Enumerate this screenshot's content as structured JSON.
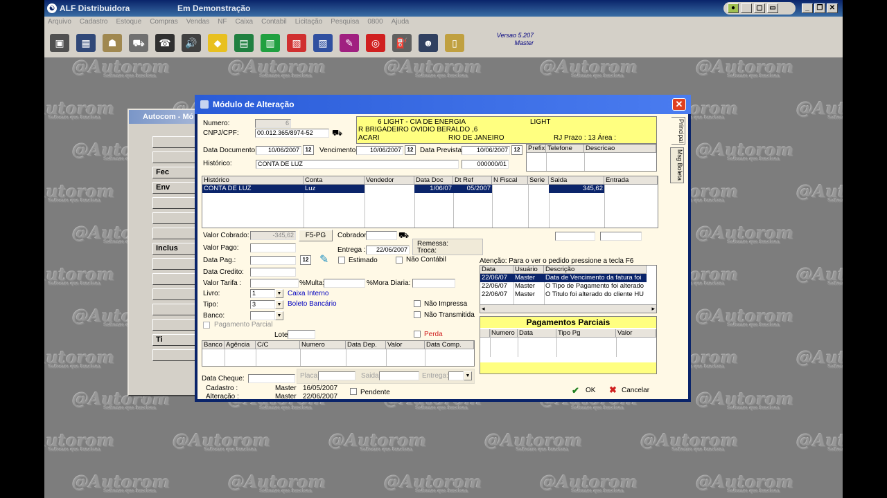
{
  "app": {
    "title": "ALF Distribuidora",
    "mode": "Em Demonstração"
  },
  "menu": [
    "Arquivo",
    "Cadastro",
    "Estoque",
    "Compras",
    "Vendas",
    "NF",
    "Caixa",
    "Contabil",
    "Licitação",
    "Pesquisa",
    "0800",
    "Ajuda"
  ],
  "toolbar_icons": [
    "printer-icon",
    "calculator-icon",
    "handshake-icon",
    "truck-icon",
    "telephone-icon",
    "speaker-icon",
    "sign-icon",
    "chart-icon",
    "money-icon",
    "document-icon",
    "notes-icon",
    "tools-icon",
    "target-icon",
    "gas-pump-icon",
    "people-icon",
    "phone-icon"
  ],
  "toolbar_colors": [
    "#505050",
    "#304878",
    "#a08850",
    "#707070",
    "#303030",
    "#404040",
    "#e8c020",
    "#208040",
    "#20a040",
    "#d03030",
    "#3050a0",
    "#a02080",
    "#d02020",
    "#606060",
    "#304060",
    "#c0a040"
  ],
  "version": {
    "line1": "Versao 5.207",
    "line2": "Master"
  },
  "watermark": {
    "text": "@Autorom",
    "tagline": "Software que funciona"
  },
  "background_window": {
    "title": "Autocom - Mó",
    "buttons": [
      "",
      "",
      "Fec",
      "Env",
      "",
      "",
      "",
      "Inclus",
      "",
      "",
      "",
      "",
      "",
      "Ti",
      ""
    ]
  },
  "dialog": {
    "title": "Módulo de Alteração",
    "tabs": [
      "Principal",
      "Msg Boleta"
    ],
    "numero_label": "Numero:",
    "numero_value": "6",
    "cnpj_label": "CNPJ/CPF:",
    "cnpj_value": "00.012.365/8974-52",
    "client_box": {
      "line1": "6    LIGHT - CIA DE ENERGIA",
      "line1b": "LIGHT",
      "line2": "R BRIGADEIRO OVIDIO BERALDO ,6",
      "line3a": "ACARI",
      "line3b": "RIO DE JANEIRO",
      "line3c": "RJ    Prazo :   13    Área :"
    },
    "data_doc_label": "Data Documento:",
    "data_doc_value": "10/06/2007",
    "vencimento_label": "Vencimento",
    "vencimento_value": "10/06/2007",
    "data_prevista_label": "Data Prevista",
    "data_prevista_value": "10/06/2007",
    "historico_label": "Histórico:",
    "historico_value": "CONTA DE LUZ",
    "historico_code": "000000/01",
    "phone_headers": [
      "Prefix",
      "Telefone",
      "Descricao"
    ],
    "cal_label": "12",
    "main_grid": {
      "headers": [
        "Histórico",
        "Conta",
        "Vendedor",
        "Data Doc",
        "Dt Ref",
        "N Fiscal",
        "Serie",
        "Saida",
        "Entrada"
      ],
      "row": [
        "CONTA DE LUZ",
        "Luz",
        "",
        "1/06/07",
        "05/2007",
        "",
        "",
        "345,62",
        ""
      ]
    },
    "valor_cobrado_label": "Valor Cobrado:",
    "valor_cobrado_value": "-345,62",
    "f5_label": "F5-PG",
    "cobrador_label": "Cobrador",
    "remessa_label": "Remessa:",
    "troca_label": "Troca:",
    "valor_pago_label": "Valor Pago:",
    "entrega_label": "Entrega :",
    "entrega_value": "22/06/2007",
    "data_pag_label": "Data Pag.:",
    "estimado_label": "Estimado",
    "nao_contabil_label": "Não Contábil",
    "data_credito_label": "Data Credito:",
    "valor_tarifa_label": "Valor Tarifa :",
    "multa_label": "%Multa:",
    "mora_label": "%Mora Diaria:",
    "livro_label": "Livro:",
    "livro_value": "1",
    "livro_desc": "Caixa Interno",
    "tipo_label": "Tipo:",
    "tipo_value": "3",
    "tipo_desc": "Boleto Bancário",
    "banco_label": "Banco:",
    "nao_impressa_label": "Não Impressa",
    "nao_transmitida_label": "Não Transmitida",
    "pagamento_parcial_label": "Pagamento Parcial",
    "lote_label": "Lote",
    "perda_label": "Perda",
    "bank_grid_headers": [
      "Banco",
      "Agência",
      "C/C",
      "Numero",
      "Data Dep.",
      "Valor",
      "Data Comp."
    ],
    "data_cheque_label": "Data Cheque:",
    "placa_label": "Placa:",
    "saida_label": "Saida",
    "entrega2_label": "Entrega:",
    "cadastro_label": "Cadastro :",
    "cadastro_user": "Master",
    "cadastro_date": "16/05/2007",
    "alteracao_label": "Alteração :",
    "alteracao_user": "Master",
    "alteracao_date": "22/06/2007",
    "pendente_label": "Pendente",
    "atencao_text": "Atenção: Para o ver o pedido pressione a tecla F6",
    "log_grid": {
      "headers": [
        "Data",
        "Usuário",
        "Descrição"
      ],
      "rows": [
        [
          "22/06/07",
          "Master",
          "Data de Vencimento da fatura foi"
        ],
        [
          "22/06/07",
          "Master",
          "O Tipo de Pagamento foi alterado"
        ],
        [
          "22/06/07",
          "Master",
          "O Titulo foi alterado do cliente HU"
        ]
      ]
    },
    "parciais": {
      "title": "Pagamentos Parciais",
      "headers": [
        "Numero",
        "Data",
        "Tipo Pg",
        "Valor"
      ]
    },
    "ok_label": "OK",
    "cancel_label": "Cancelar"
  }
}
